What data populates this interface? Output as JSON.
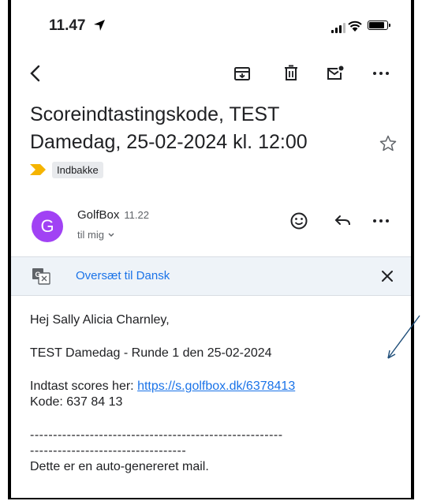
{
  "status_bar": {
    "time": "11.47"
  },
  "email": {
    "subject_line1": "Scoreindtastingskode, TEST",
    "subject_line2": "Damedag, 25-02-2024 kl. 12:00",
    "label": "Indbakke",
    "sender": {
      "avatar_letter": "G",
      "name": "GolfBox",
      "time": "11.22",
      "to": "til mig"
    },
    "translate": {
      "link": "Oversæt til Dansk"
    },
    "body": {
      "greeting": "Hej Sally Alicia Charnley,",
      "event": "TEST Damedag - Runde 1 den 25-02-2024",
      "scores_prefix": "Indtast scores her:",
      "scores_link": "https://s.golfbox.dk/6378413",
      "code": "Kode: 637 84 13",
      "divider1": "-------------------------------------------------------",
      "divider2": "----------------------------------",
      "footer": "Dette er en auto-genereret mail."
    }
  },
  "colors": {
    "avatar": "#a142f4",
    "link": "#1a73e8",
    "label_marker": "#f5b400",
    "translate_bar": "#eef3f8"
  },
  "icons": [
    "back-icon",
    "archive-icon",
    "trash-icon",
    "mark-unread-icon",
    "more-icon",
    "star-icon",
    "emoji-icon",
    "reply-icon",
    "google-translate-icon",
    "close-icon"
  ]
}
